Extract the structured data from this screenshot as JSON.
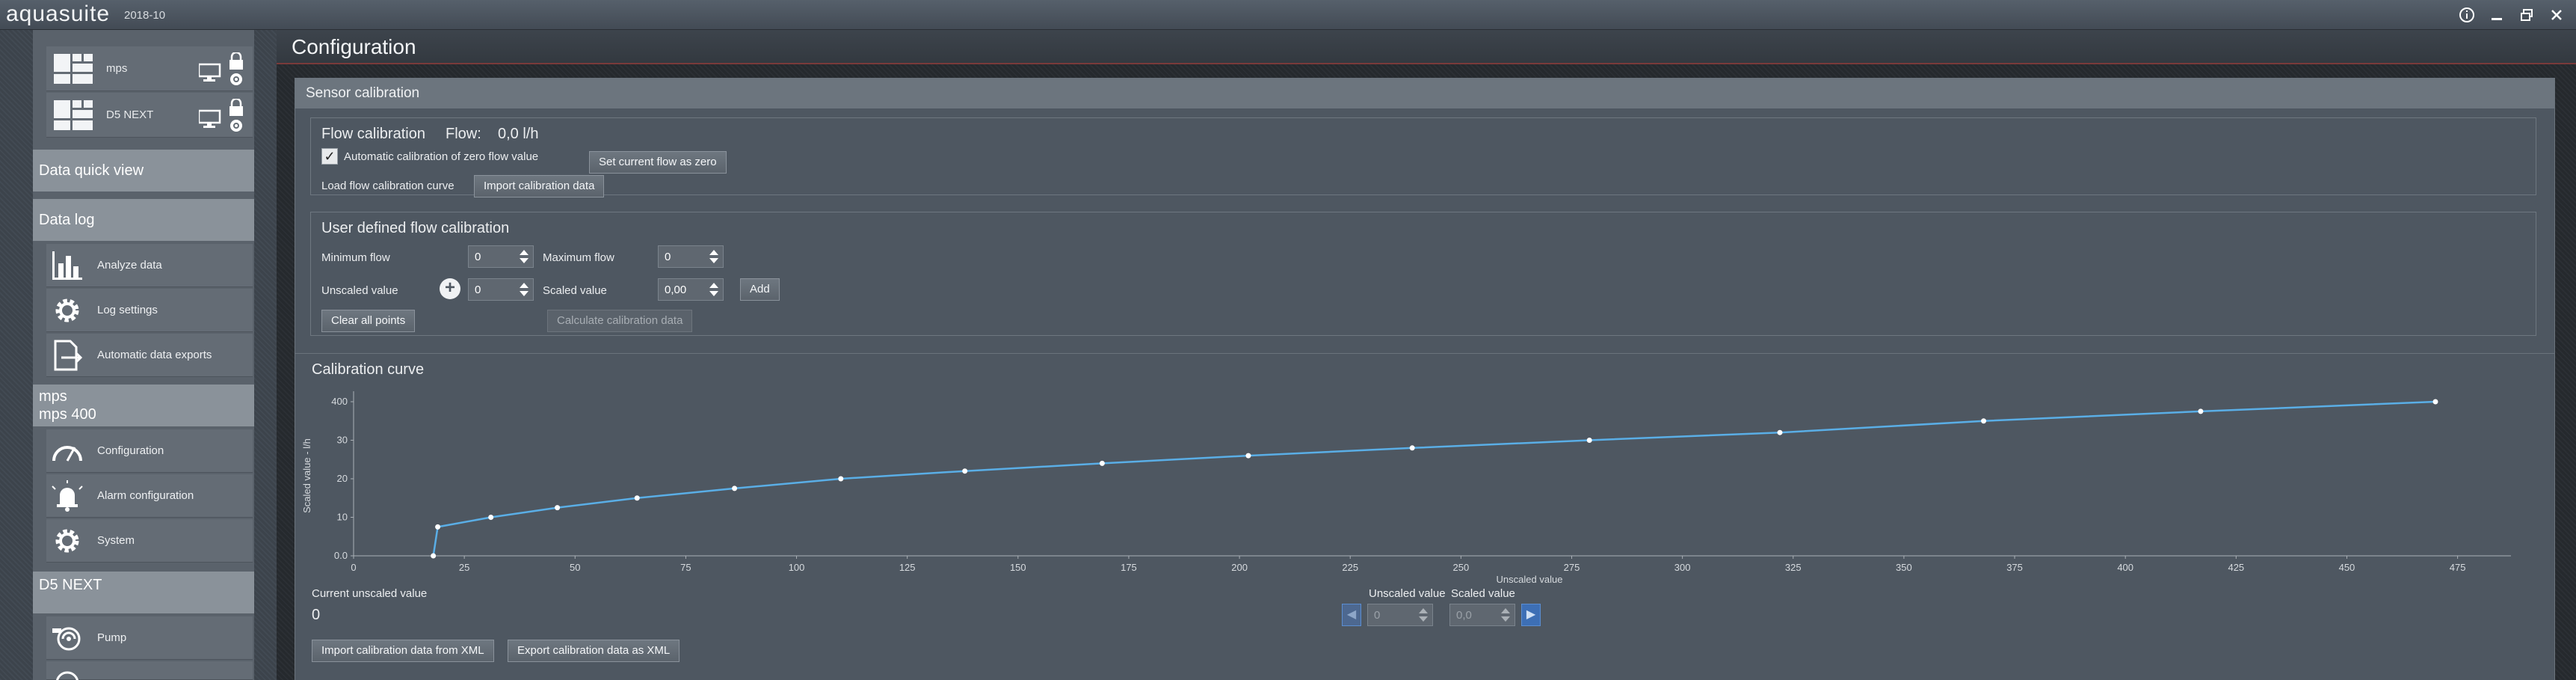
{
  "app": {
    "name": "aquasuite",
    "version": "2018-10",
    "window_buttons": [
      "info-icon",
      "minimize-icon",
      "restore-icon",
      "close-icon"
    ]
  },
  "sidebar": {
    "devices": [
      {
        "label": "mps"
      },
      {
        "label": "D5 NEXT"
      }
    ],
    "data_quick_view": "Data quick view",
    "data_log": "Data log",
    "data_log_items": [
      {
        "label": "Analyze data",
        "icon": "bar-chart-icon"
      },
      {
        "label": "Log settings",
        "icon": "gear-icon"
      },
      {
        "label": "Automatic data exports",
        "icon": "export-icon"
      }
    ],
    "mps_group": {
      "line1": "mps",
      "line2": "mps 400"
    },
    "mps_items": [
      {
        "label": "Configuration",
        "icon": "gauge-icon"
      },
      {
        "label": "Alarm configuration",
        "icon": "alarm-bell-icon"
      },
      {
        "label": "System",
        "icon": "gear-icon"
      }
    ],
    "d5_group": "D5 NEXT",
    "d5_items": [
      {
        "label": "Pump",
        "icon": "pump-icon"
      }
    ]
  },
  "main": {
    "title": "Configuration",
    "sensor_calibration": {
      "header": "Sensor calibration",
      "flow_calibration": {
        "title": "Flow calibration",
        "flow_label": "Flow:",
        "flow_value": "0,0 l/h",
        "auto_zero_label": "Automatic calibration of zero flow value",
        "auto_zero_checked": true,
        "set_zero_button": "Set current flow as zero",
        "load_curve_label": "Load flow calibration curve",
        "import_button": "Import calibration data"
      },
      "user_defined": {
        "title": "User defined flow calibration",
        "min_flow_label": "Minimum flow",
        "min_flow_value": "0",
        "max_flow_label": "Maximum flow",
        "max_flow_value": "0",
        "unscaled_label": "Unscaled value",
        "unscaled_value": "0",
        "scaled_label": "Scaled value",
        "scaled_value": "0,00",
        "add_button": "Add",
        "clear_button": "Clear all points",
        "calculate_button": "Calculate calibration data"
      }
    },
    "calibration_curve": {
      "header": "Calibration curve",
      "current_unscaled_label": "Current unscaled value",
      "current_unscaled_value": "0",
      "unscaled_label": "Unscaled value",
      "unscaled_value": "0",
      "scaled_label": "Scaled value",
      "scaled_value": "0,0",
      "import_xml_button": "Import calibration data from XML",
      "export_xml_button": "Export calibration data as XML"
    }
  },
  "chart_data": {
    "type": "line",
    "xlabel": "Unscaled value",
    "ylabel": "Scaled value - l/h",
    "x_ticks": [
      "0",
      "25",
      "50",
      "75",
      "100",
      "125",
      "150",
      "175",
      "200",
      "225",
      "250",
      "275",
      "300",
      "325",
      "350",
      "375",
      "400",
      "425",
      "450",
      "475"
    ],
    "y_ticks": [
      "0.0",
      "10",
      "20",
      "30",
      "400"
    ],
    "xlim": [
      0,
      483
    ],
    "line_color": "#5aaee6",
    "points": [
      {
        "x": 18,
        "y": 0
      },
      {
        "x": 19,
        "y": 7.5
      },
      {
        "x": 31,
        "y": 10
      },
      {
        "x": 46,
        "y": 12.5
      },
      {
        "x": 64,
        "y": 15
      },
      {
        "x": 86,
        "y": 17.5
      },
      {
        "x": 110,
        "y": 20
      },
      {
        "x": 138,
        "y": 22
      },
      {
        "x": 169,
        "y": 24
      },
      {
        "x": 202,
        "y": 26
      },
      {
        "x": 239,
        "y": 28
      },
      {
        "x": 279,
        "y": 30
      },
      {
        "x": 322,
        "y": 32
      },
      {
        "x": 368,
        "y": 35
      },
      {
        "x": 417,
        "y": 37.5
      },
      {
        "x": 470,
        "y": 40
      }
    ]
  }
}
